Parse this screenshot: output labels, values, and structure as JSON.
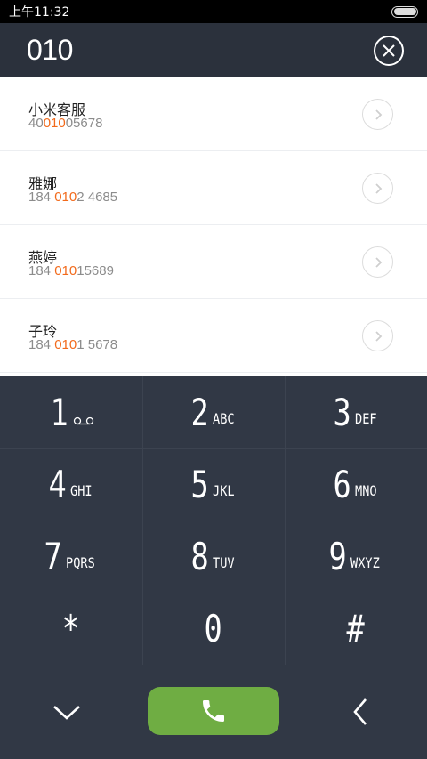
{
  "status_bar": {
    "time": "上午11:32",
    "battery_level": 1.0
  },
  "search": {
    "query": "010"
  },
  "results": [
    {
      "name": "小米客服",
      "number_prefix": "40",
      "number_match": "010",
      "number_suffix": "05678"
    },
    {
      "name": "雅娜",
      "number_prefix": "184 ",
      "number_match": "010",
      "number_suffix": "2 4685"
    },
    {
      "name": "燕婷",
      "number_prefix": "184 ",
      "number_match": "010",
      "number_suffix": "15689"
    },
    {
      "name": "子玲",
      "number_prefix": "184 ",
      "number_match": "010",
      "number_suffix": "1 5678"
    }
  ],
  "keypad": {
    "keys": [
      {
        "digit": "1",
        "letters": ""
      },
      {
        "digit": "2",
        "letters": "ABC"
      },
      {
        "digit": "3",
        "letters": "DEF"
      },
      {
        "digit": "4",
        "letters": "GHI"
      },
      {
        "digit": "5",
        "letters": "JKL"
      },
      {
        "digit": "6",
        "letters": "MNO"
      },
      {
        "digit": "7",
        "letters": "PQRS"
      },
      {
        "digit": "8",
        "letters": "TUV"
      },
      {
        "digit": "9",
        "letters": "WXYZ"
      },
      {
        "digit": "*",
        "letters": ""
      },
      {
        "digit": "0",
        "letters": ""
      },
      {
        "digit": "#",
        "letters": ""
      }
    ],
    "voicemail_icon": "voicemail-icon"
  },
  "bottom_bar": {
    "collapse_icon": "chevron-down-icon",
    "call_icon": "phone-icon",
    "backspace_icon": "chevron-left-icon",
    "call_color": "#6fad43"
  },
  "colors": {
    "highlight": "#f26a1b",
    "header_bg": "#2b313c",
    "keypad_bg": "#313845"
  }
}
